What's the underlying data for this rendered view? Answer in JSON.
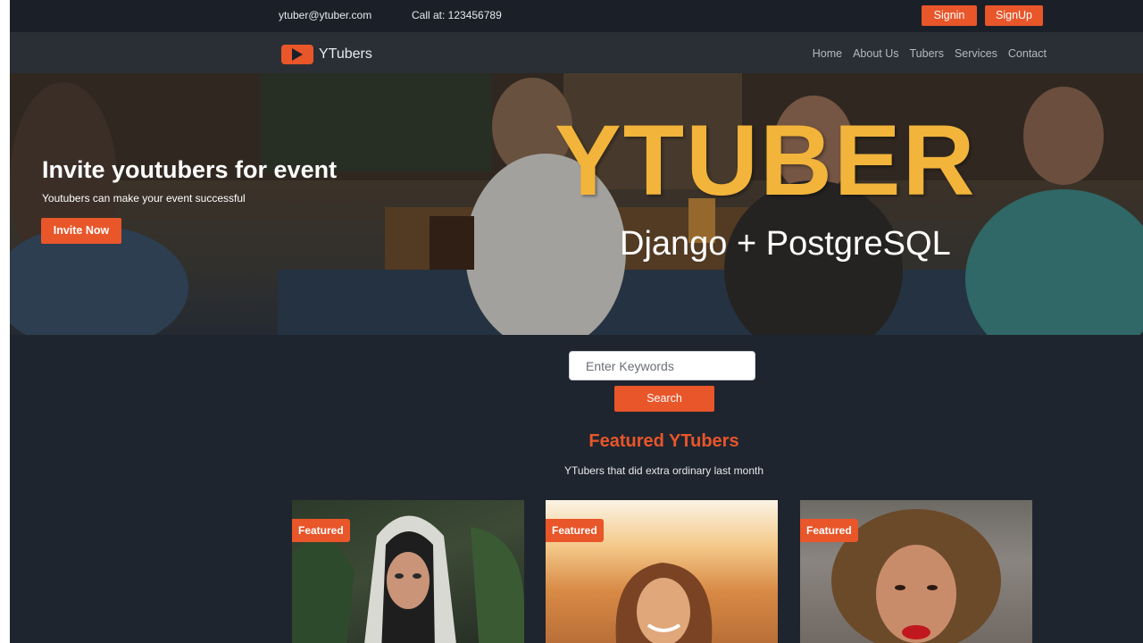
{
  "topbar": {
    "email": "ytuber@ytuber.com",
    "phone": "Call at: 123456789",
    "signin_label": "Signin",
    "signup_label": "SignUp"
  },
  "nav": {
    "brand": "YTubers",
    "links": [
      "Home",
      "About Us",
      "Tubers",
      "Services",
      "Contact"
    ]
  },
  "hero": {
    "title": "Invite youtubers for event",
    "subtitle": "Youtubers can make your event successful",
    "button_label": "Invite Now",
    "overlay_title": "YTUBER",
    "overlay_subtitle": "Django + PostgreSQL"
  },
  "search": {
    "placeholder": "Enter Keywords",
    "button_label": "Search"
  },
  "featured": {
    "title": "Featured YTubers",
    "subtitle": "YTubers that did extra ordinary last month",
    "badge": "Featured"
  },
  "colors": {
    "accent": "#e8562a",
    "background": "#1f252e",
    "overlay_title": "#f2b43a"
  }
}
